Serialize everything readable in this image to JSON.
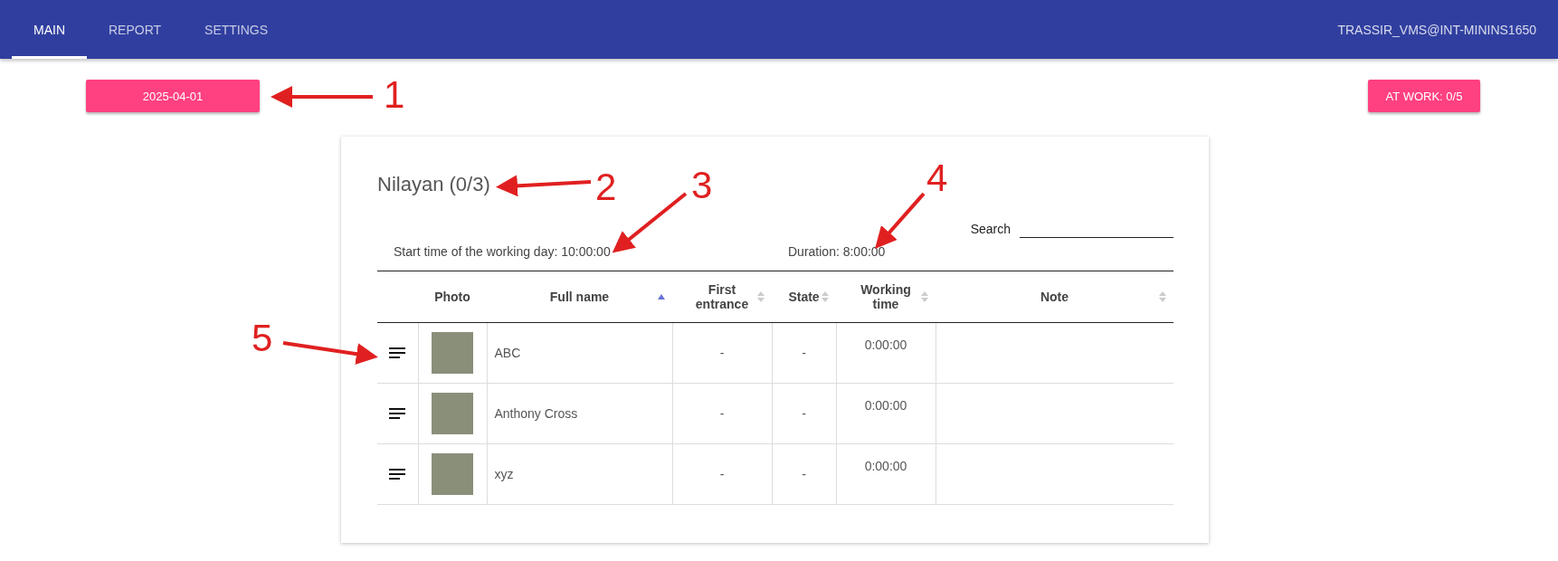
{
  "nav": {
    "tabs": [
      {
        "label": "MAIN",
        "selected": true
      },
      {
        "label": "REPORT",
        "selected": false
      },
      {
        "label": "SETTINGS",
        "selected": false
      }
    ],
    "user": "TRASSIR_VMS@INT-MININS1650"
  },
  "date_button": "2025-04-01",
  "at_work_button": "AT WORK: 0/5",
  "card": {
    "title": "Nilayan (0/3)",
    "search": {
      "label": "Search"
    },
    "start_time": "Start time of the working day: 10:00:00",
    "duration": "Duration: 8:00:00",
    "table": {
      "columns": [
        {
          "label": "Photo"
        },
        {
          "label": "Full name",
          "sorted": true
        },
        {
          "label": "First entrance",
          "sorted": false
        },
        {
          "label": "State",
          "sorted": false
        },
        {
          "label": "Working time",
          "sorted": false
        },
        {
          "label": "Note",
          "sorted": false
        }
      ],
      "rows": [
        {
          "name": "ABC",
          "first_entrance": "-",
          "state": "-",
          "working_time": "0:00:00"
        },
        {
          "name": "Anthony Cross",
          "first_entrance": "-",
          "state": "-",
          "working_time": "0:00:00"
        },
        {
          "name": "xyz",
          "first_entrance": "-",
          "state": "-",
          "working_time": "0:00:00"
        }
      ]
    }
  },
  "callouts": [
    "1",
    "2",
    "3",
    "4",
    "5"
  ]
}
